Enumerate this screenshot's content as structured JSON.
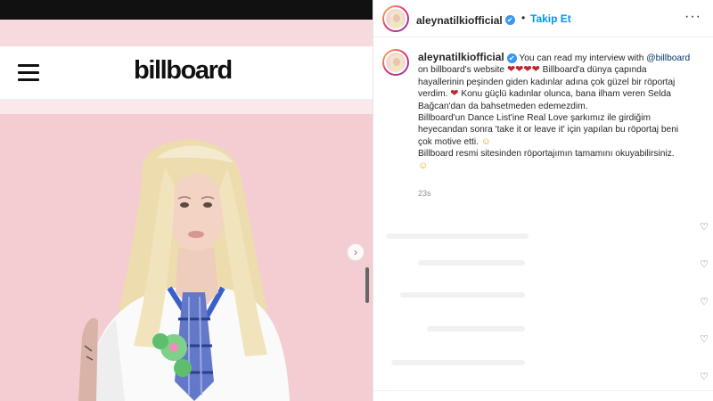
{
  "left_panel": {
    "site_logo": "billboard",
    "menu_icon": "hamburger-menu-icon",
    "next_icon": "chevron-right-icon",
    "next_glyph": "›"
  },
  "post": {
    "header": {
      "username": "aleynatilkiofficial",
      "verified_glyph": "✔",
      "separator": "•",
      "follow_label": "Takip Et",
      "more_glyph": "···"
    },
    "caption": {
      "username": "aleynatilkiofficial",
      "verified_glyph": "✔",
      "l1_text": "You can read my interview with",
      "l1_mention": "@billboard",
      "l2_text_a": "on billboard's website",
      "l2_hearts": "❤❤❤❤",
      "l2_text_b": "Billboard'a dünya çapında",
      "l3": "hayallerinin peşinden giden kadınlar adına çok güzel bir röportaj",
      "l4_text_a": "verdim.",
      "l4_heart": "❤",
      "l4_text_b": "Konu güçlü kadınlar olunca, bana ilham veren Selda",
      "l5": "Bağcan'dan da bahsetmeden edemezdim.",
      "l6": "Billboard'un Dance List'ine Real Love şarkımız ile girdiğim",
      "l7": "heyecandan sonra 'take it or leave it' için yapılan bu röportaj beni",
      "l8_text": "çok motive etti.",
      "l8_emoji": "☺",
      "l9": "Billboard resmi sitesinden röportajımın tamamını okuyabilirsiniz.",
      "l10_emoji": "☺"
    },
    "time_ago": "23s",
    "like_glyph": "♡"
  },
  "colors": {
    "accent_blue": "#0095f6",
    "verified_blue": "#3897f0",
    "heart_red": "#c0272d",
    "photo_bg": "#f4cdd2"
  }
}
